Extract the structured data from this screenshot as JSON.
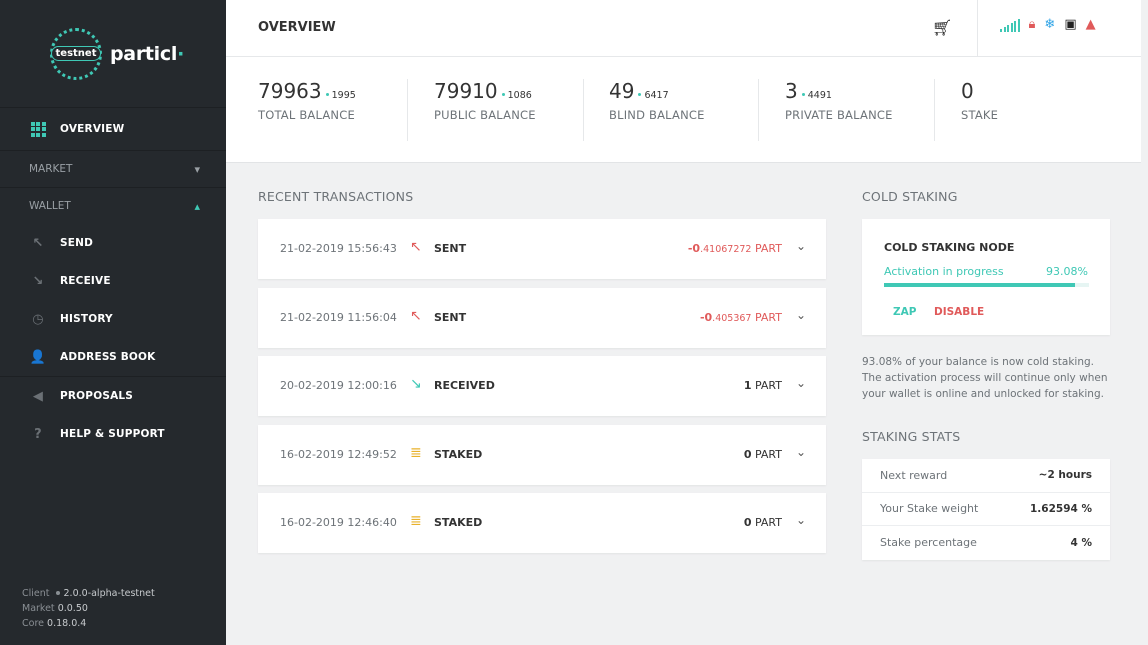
{
  "sidebar": {
    "logo": {
      "badge": "testnet",
      "name": "particl"
    },
    "overview": "OVERVIEW",
    "market": "MARKET",
    "wallet": "WALLET",
    "send": "SEND",
    "receive": "RECEIVE",
    "history": "HISTORY",
    "address_book": "ADDRESS BOOK",
    "proposals": "PROPOSALS",
    "help": "HELP & SUPPORT",
    "footer": {
      "client_label": "Client",
      "client_value": "2.0.0-alpha-testnet",
      "market_label": "Market",
      "market_value": "0.0.50",
      "core_label": "Core",
      "core_value": "0.18.0.4"
    }
  },
  "header": {
    "title": "OVERVIEW"
  },
  "balances": [
    {
      "whole": "79963",
      "decimal": "1995",
      "label": "TOTAL BALANCE"
    },
    {
      "whole": "79910",
      "decimal": "1086",
      "label": "PUBLIC BALANCE"
    },
    {
      "whole": "49",
      "decimal": "6417",
      "label": "BLIND BALANCE"
    },
    {
      "whole": "3",
      "decimal": "4491",
      "label": "PRIVATE BALANCE"
    },
    {
      "whole": "0",
      "decimal": "",
      "label": "STAKE"
    }
  ],
  "recent": {
    "title": "RECENT TRANSACTIONS",
    "items": [
      {
        "date": "21-02-2019 15:56:43",
        "type": "SENT",
        "amount_big": "-0",
        "amount_small": ".41067272",
        "unit": "PART"
      },
      {
        "date": "21-02-2019 11:56:04",
        "type": "SENT",
        "amount_big": "-0",
        "amount_small": ".405367",
        "unit": "PART"
      },
      {
        "date": "20-02-2019 12:00:16",
        "type": "RECEIVED",
        "amount_big": "1",
        "amount_small": "",
        "unit": "PART"
      },
      {
        "date": "16-02-2019 12:49:52",
        "type": "STAKED",
        "amount_big": "0",
        "amount_small": "",
        "unit": "PART"
      },
      {
        "date": "16-02-2019 12:46:40",
        "type": "STAKED",
        "amount_big": "0",
        "amount_small": "",
        "unit": "PART"
      }
    ]
  },
  "cold_staking": {
    "title": "COLD STAKING",
    "node_title": "COLD STAKING NODE",
    "progress_label": "Activation in progress",
    "progress_value": "93.08%",
    "progress_fraction": 0.9308,
    "zap": "ZAP",
    "disable": "DISABLE",
    "note": "93.08% of your balance is now cold staking. The activation process will continue only when your wallet is online and unlocked for staking."
  },
  "staking_stats": {
    "title": "STAKING STATS",
    "rows": [
      {
        "key": "Next reward",
        "value": "~2 hours"
      },
      {
        "key": "Your Stake weight",
        "value": "1.62594 %"
      },
      {
        "key": "Stake percentage",
        "value": "4 %"
      }
    ]
  },
  "colors": {
    "accent": "#3fc8b5",
    "negative": "#e05a5a",
    "staked": "#e8b22c",
    "sidebar": "#25292d"
  }
}
